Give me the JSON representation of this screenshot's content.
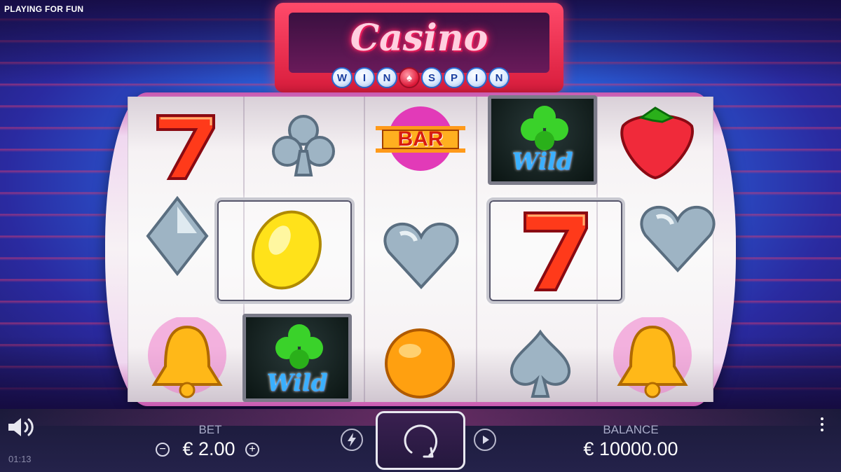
{
  "header": {
    "mode_label": "PLAYING FOR FUN"
  },
  "logo": {
    "line1": "Casino",
    "line2_letters": [
      "W",
      "I",
      "N",
      "♠",
      "S",
      "P",
      "I",
      "N"
    ]
  },
  "reels": {
    "symbols": [
      [
        "seven",
        "diamond-suit",
        "bell"
      ],
      [
        "club-suit",
        "lemon",
        "wild"
      ],
      [
        "bar",
        "heart-suit",
        "orange"
      ],
      [
        "wild",
        "seven",
        "spade-suit"
      ],
      [
        "strawberry",
        "heart-suit",
        "bell"
      ]
    ],
    "bar_label": "BAR",
    "wild_label": "Wild"
  },
  "controls": {
    "bet_label": "BET",
    "bet_value": "€ 2.00",
    "bet_minus": "−",
    "bet_plus": "+",
    "balance_label": "BALANCE",
    "balance_value": "€ 10000.00",
    "clock": "01:13"
  },
  "colors": {
    "accent_red": "#e01838",
    "bottom_bar": "#1b1a3a",
    "text_muted": "#a9abc8"
  }
}
